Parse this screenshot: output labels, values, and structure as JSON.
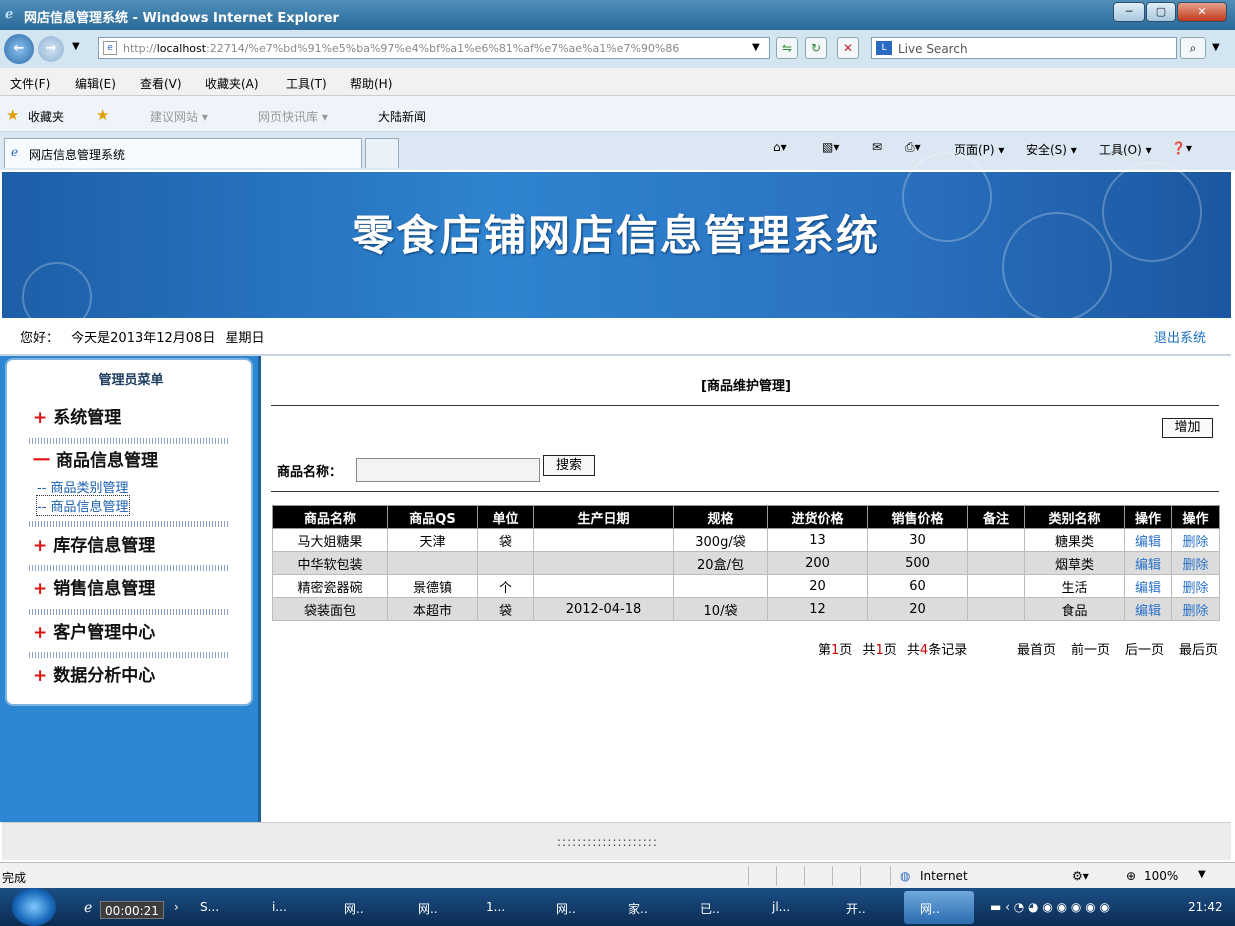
{
  "window": {
    "title": "网店信息管理系统 - Windows Internet Explorer",
    "min": "─",
    "max": "▢",
    "close": "✕"
  },
  "addressbar": {
    "url_prefix": "http://",
    "url_host": "localhost",
    "url_rest": ":22714/%e7%bd%91%e5%ba%97%e4%bf%a1%e6%81%af%e7%ae%a1%e7%90%86",
    "search_placeholder": "Live Search"
  },
  "menubar": [
    "文件(F)",
    "编辑(E)",
    "查看(V)",
    "收藏夹(A)",
    "工具(T)",
    "帮助(H)"
  ],
  "favbar": {
    "label": "收藏夹",
    "items": [
      "建议网站 ▾",
      "网页快讯库 ▾",
      "大陆新闻"
    ]
  },
  "tab": {
    "label": "网店信息管理系统"
  },
  "commandbar": [
    "页面(P) ▾",
    "安全(S) ▾",
    "工具(O) ▾"
  ],
  "banner": {
    "title": "零食店铺网店信息管理系统"
  },
  "greeting": {
    "hello": "您好：",
    "date": "今天是2013年12月08日",
    "weekday": "星期日",
    "logout": "退出系统"
  },
  "sidebar": {
    "title": "管理员菜单",
    "sections": [
      {
        "icon": "+",
        "label": "系统管理"
      },
      {
        "icon": "一",
        "label": "商品信息管理"
      },
      {
        "icon": "+",
        "label": "库存信息管理"
      },
      {
        "icon": "+",
        "label": "销售信息管理"
      },
      {
        "icon": "+",
        "label": "客户管理中心"
      },
      {
        "icon": "+",
        "label": "数据分析中心"
      }
    ],
    "subitems": [
      "-- 商品类别管理",
      "-- 商品信息管理"
    ]
  },
  "content": {
    "title": "[商品维护管理]",
    "add_button": "增加",
    "search_label": "商品名称：",
    "search_button": "搜索",
    "columns": [
      "商品名称",
      "商品QS",
      "单位",
      "生产日期",
      "规格",
      "进货价格",
      "销售价格",
      "备注",
      "类别名称",
      "操作",
      "操作"
    ],
    "rows": [
      [
        "马大姐糖果",
        "天津",
        "袋",
        "",
        "300g/袋",
        "13",
        "30",
        "",
        "糖果类",
        "编辑",
        "删除"
      ],
      [
        "中华软包装",
        "",
        "",
        "",
        "20盒/包",
        "200",
        "500",
        "",
        "烟草类",
        "编辑",
        "删除"
      ],
      [
        "精密瓷器碗",
        "景德镇",
        "个",
        "",
        "",
        "20",
        "60",
        "",
        "生活",
        "编辑",
        "删除"
      ],
      [
        "袋装面包",
        "本超市",
        "袋",
        "2012-04-18",
        "10/袋",
        "12",
        "20",
        "",
        "食品",
        "编辑",
        "删除"
      ]
    ],
    "pager": {
      "page_prefix": "第",
      "page": "1",
      "page_suffix": "页",
      "total_prefix": "共",
      "total_pages": "1",
      "total_suffix": "页",
      "rec_prefix": "共",
      "records": "4",
      "rec_suffix": "条记录",
      "first": "最首页",
      "prev": "前一页",
      "next": "后一页",
      "last": "最后页"
    }
  },
  "footer": {
    "text": "::::::::::::::::::::"
  },
  "status": {
    "left": "完成",
    "zone": "Internet",
    "zoom": "100%"
  },
  "taskbar": {
    "timer": "00:00:21",
    "tasks": [
      "S...",
      "i...",
      "网..",
      "网..",
      "1...",
      "网..",
      "家..",
      "已..",
      "jl...",
      "开..",
      "网.."
    ],
    "clock": "21:42"
  }
}
